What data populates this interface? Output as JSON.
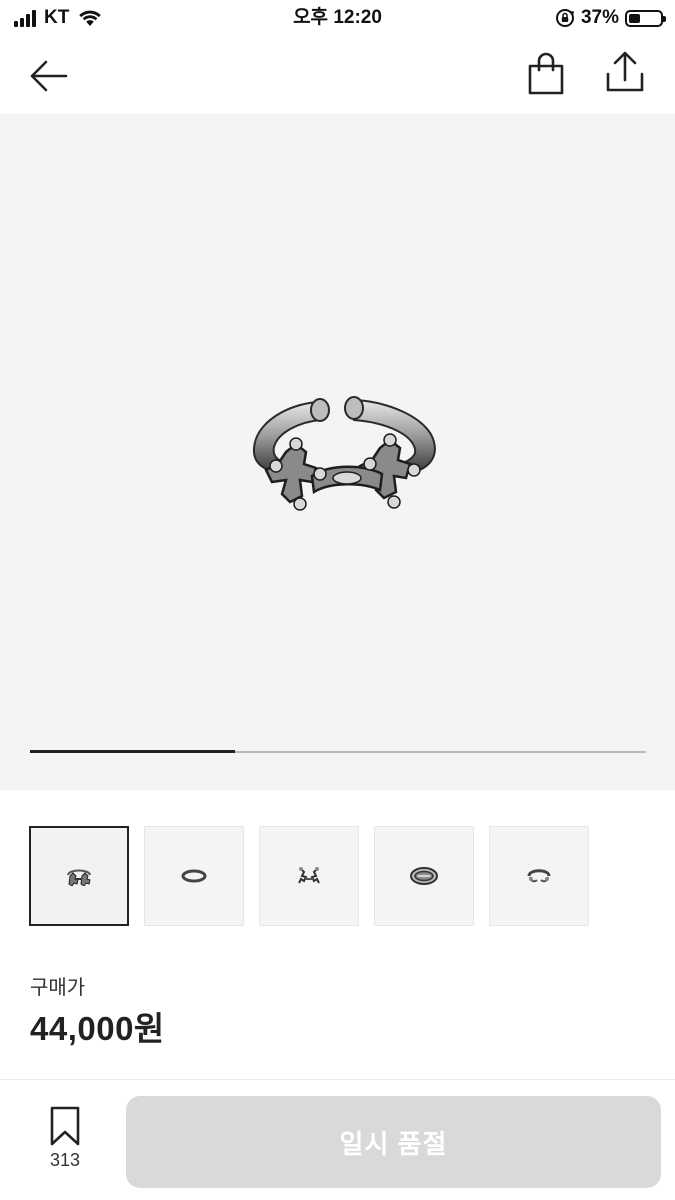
{
  "status_bar": {
    "carrier": "KT",
    "time": "오후 12:20",
    "battery_percent": "37%",
    "battery_level": 0.37
  },
  "nav": {
    "back_icon": "arrow-left-icon",
    "bag_icon": "shopping-bag-icon",
    "share_icon": "share-upload-icon"
  },
  "gallery": {
    "image_count": 5,
    "current_index": 1,
    "progress_fraction": 0.333
  },
  "thumbnails": [
    {
      "label": "ring-view-1",
      "selected": true
    },
    {
      "label": "ring-view-2",
      "selected": false
    },
    {
      "label": "ring-view-3",
      "selected": false
    },
    {
      "label": "ring-view-4",
      "selected": false
    },
    {
      "label": "ring-view-5",
      "selected": false
    }
  ],
  "price": {
    "label": "구매가",
    "value": "44,000원"
  },
  "bottom_bar": {
    "bookmark_count": "313",
    "button_label": "일시 품절",
    "button_color": "#d9d9d9"
  },
  "colors": {
    "image_background": "#f4f4f4",
    "progress_active": "#222222",
    "progress_track": "#b9b9b9"
  }
}
